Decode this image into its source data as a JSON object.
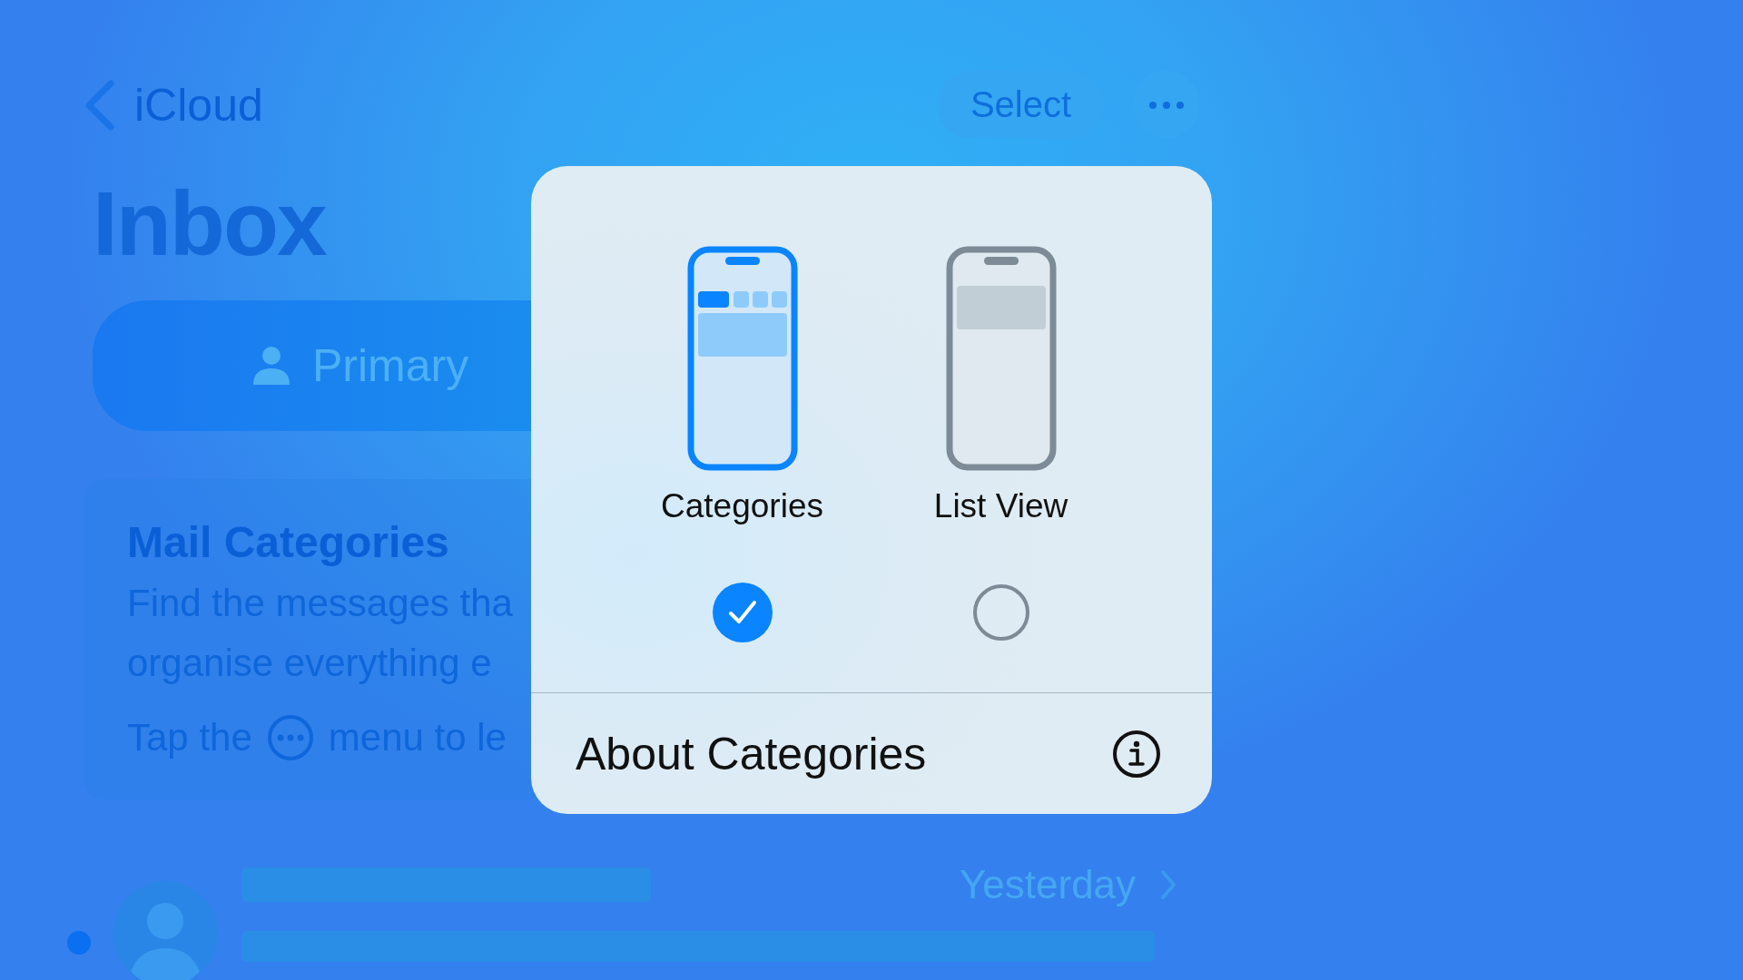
{
  "nav": {
    "back_label": "iCloud",
    "select_button": "Select"
  },
  "title": "Inbox",
  "primary_tab": {
    "label": "Primary"
  },
  "info_card": {
    "title": "Mail Categories",
    "lines": [
      "Find the messages tha",
      "organise everything e"
    ],
    "hint_before": "Tap the",
    "hint_after": "menu to le"
  },
  "message_row": {
    "unread": true,
    "time": "Yesterday"
  },
  "popup": {
    "options": [
      {
        "label": "Categories",
        "kind": "categories",
        "selected": true
      },
      {
        "label": "List View",
        "kind": "list",
        "selected": false
      }
    ],
    "about": "About Categories"
  }
}
